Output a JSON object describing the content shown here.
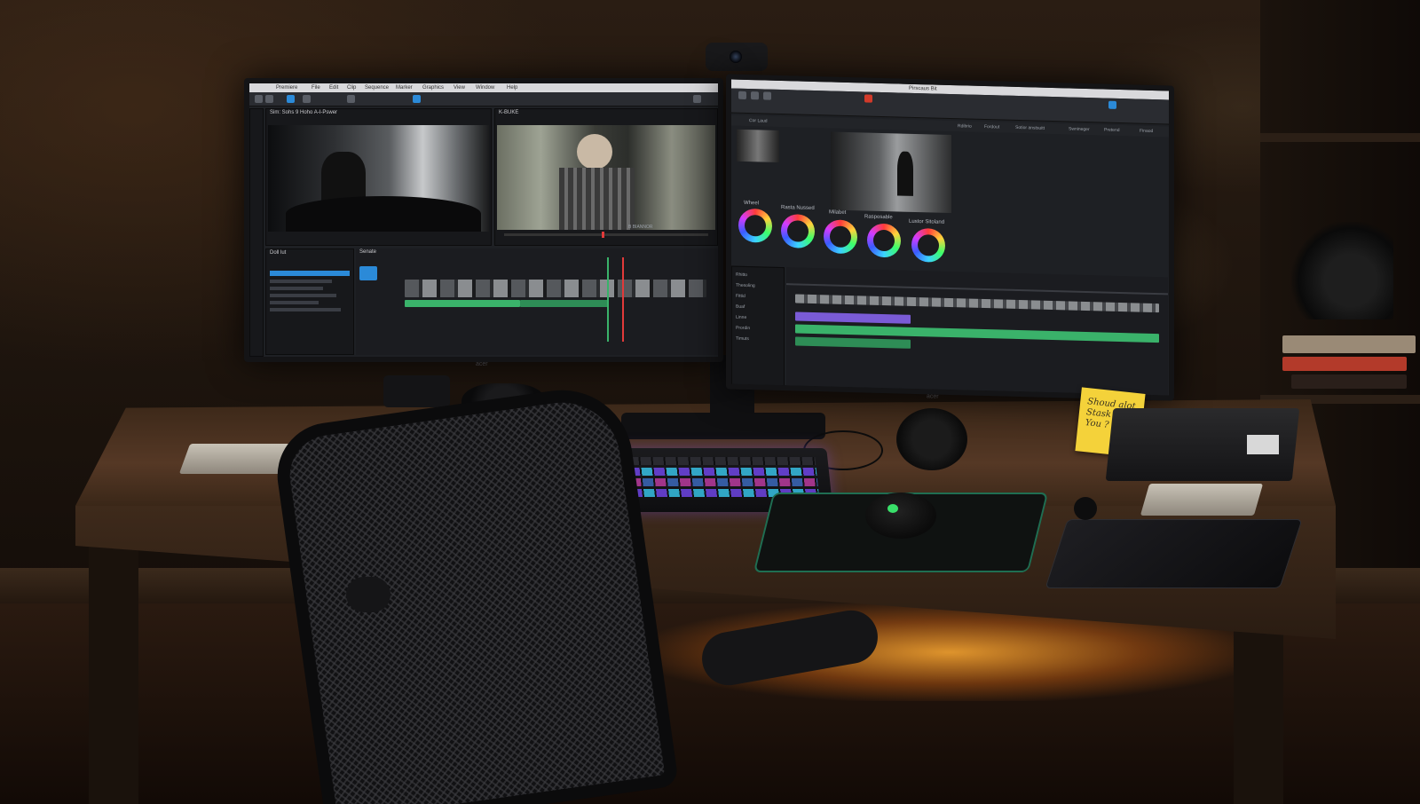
{
  "scene": {
    "description_colors": {
      "led": "#ffaa32",
      "accent_blue": "#2b8ad8",
      "timeline_green": "#3ab26a",
      "timeline_purple": "#7a5bd6",
      "playhead_red": "#e23a3a"
    }
  },
  "left_monitor": {
    "menu_items": [
      "Premiere",
      "File",
      "Edit",
      "Clip",
      "Sequence",
      "Marker",
      "Graphics",
      "View",
      "Window",
      "Help"
    ],
    "source_title": "Sim: Sohs 9 Hoho A-I-Pswer",
    "program_title": "K-BUKE",
    "brand": "acer",
    "bin_header": "Doll lut",
    "timeline_tools": "Senate",
    "program_caption": "B BIANNOR"
  },
  "right_monitor": {
    "title": "Pirscaus Bit",
    "tabs": [
      "Cor Laud",
      "Rdibrio",
      "Fordout",
      "Sotior anstsuitt",
      "Swnineger",
      "Pretend",
      "Finaod"
    ],
    "wheel_labels": [
      "Wheel",
      "Rasta Nussed",
      "Milabet",
      "Rasposable",
      "Lustor Sitoland"
    ],
    "brand": "acer",
    "sidebar_items": [
      "Rhitto",
      "Thesoling",
      "Fittid",
      "Buaf",
      "Linne",
      "Prordin",
      "Timuts"
    ]
  },
  "sticky_note": {
    "text": "Shoud alot Stask of a You ?"
  }
}
